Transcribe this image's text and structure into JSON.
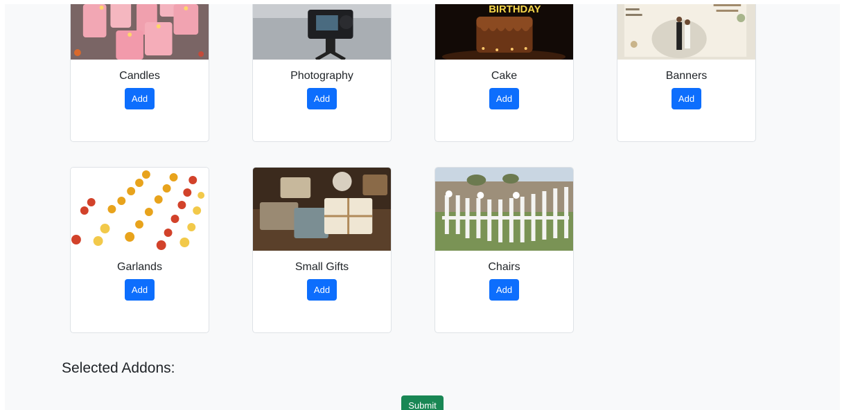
{
  "addons": [
    {
      "name": "Candles",
      "button": "Add"
    },
    {
      "name": "Photography",
      "button": "Add"
    },
    {
      "name": "Cake",
      "button": "Add"
    },
    {
      "name": "Banners",
      "button": "Add"
    },
    {
      "name": "Garlands",
      "button": "Add"
    },
    {
      "name": "Small Gifts",
      "button": "Add"
    },
    {
      "name": "Chairs",
      "button": "Add"
    }
  ],
  "cake_image_text": "BIRTHDAY",
  "selected_heading": "Selected Addons:",
  "submit_label": "Submit",
  "colors": {
    "primary": "#0d6efd",
    "success": "#198754",
    "background": "#f8f9fa",
    "card_border": "#dee2e6"
  }
}
